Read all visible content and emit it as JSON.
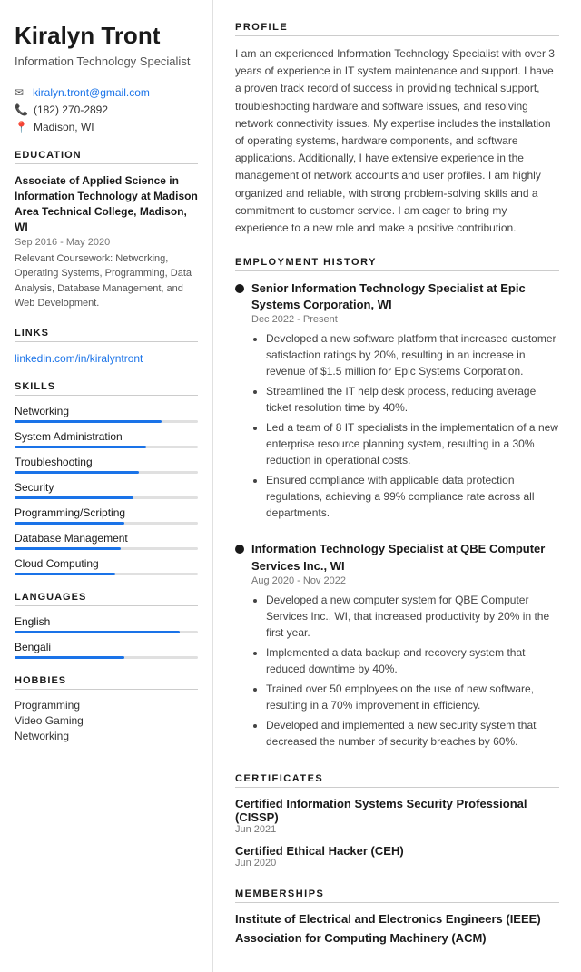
{
  "sidebar": {
    "name": "Kiralyn Tront",
    "title": "Information Technology Specialist",
    "contact": {
      "email": "kiralyn.tront@gmail.com",
      "phone": "(182) 270-2892",
      "location": "Madison, WI"
    },
    "education_title": "EDUCATION",
    "education": {
      "degree": "Associate of Applied Science in Information Technology at Madison Area Technical College, Madison, WI",
      "date": "Sep 2016 - May 2020",
      "courses": "Relevant Coursework: Networking, Operating Systems, Programming, Data Analysis, Database Management, and Web Development."
    },
    "links_title": "LINKS",
    "links": [
      {
        "text": "linkedin.com/in/kiralyntront",
        "url": "#"
      }
    ],
    "skills_title": "SKILLS",
    "skills": [
      {
        "name": "Networking",
        "pct": 80
      },
      {
        "name": "System Administration",
        "pct": 72
      },
      {
        "name": "Troubleshooting",
        "pct": 68
      },
      {
        "name": "Security",
        "pct": 65
      },
      {
        "name": "Programming/Scripting",
        "pct": 60
      },
      {
        "name": "Database Management",
        "pct": 58
      },
      {
        "name": "Cloud Computing",
        "pct": 55
      }
    ],
    "languages_title": "LANGUAGES",
    "languages": [
      {
        "name": "English",
        "pct": 90
      },
      {
        "name": "Bengali",
        "pct": 60
      }
    ],
    "hobbies_title": "HOBBIES",
    "hobbies": [
      "Programming",
      "Video Gaming",
      "Networking"
    ]
  },
  "main": {
    "profile_title": "PROFILE",
    "profile_text": "I am an experienced Information Technology Specialist with over 3 years of experience in IT system maintenance and support. I have a proven track record of success in providing technical support, troubleshooting hardware and software issues, and resolving network connectivity issues. My expertise includes the installation of operating systems, hardware components, and software applications. Additionally, I have extensive experience in the management of network accounts and user profiles. I am highly organized and reliable, with strong problem-solving skills and a commitment to customer service. I am eager to bring my experience to a new role and make a positive contribution.",
    "employment_title": "EMPLOYMENT HISTORY",
    "jobs": [
      {
        "title": "Senior Information Technology Specialist at Epic Systems Corporation, WI",
        "date": "Dec 2022 - Present",
        "bullets": [
          "Developed a new software platform that increased customer satisfaction ratings by 20%, resulting in an increase in revenue of $1.5 million for Epic Systems Corporation.",
          "Streamlined the IT help desk process, reducing average ticket resolution time by 40%.",
          "Led a team of 8 IT specialists in the implementation of a new enterprise resource planning system, resulting in a 30% reduction in operational costs.",
          "Ensured compliance with applicable data protection regulations, achieving a 99% compliance rate across all departments."
        ]
      },
      {
        "title": "Information Technology Specialist at QBE Computer Services Inc., WI",
        "date": "Aug 2020 - Nov 2022",
        "bullets": [
          "Developed a new computer system for QBE Computer Services Inc., WI, that increased productivity by 20% in the first year.",
          "Implemented a data backup and recovery system that reduced downtime by 40%.",
          "Trained over 50 employees on the use of new software, resulting in a 70% improvement in efficiency.",
          "Developed and implemented a new security system that decreased the number of security breaches by 60%."
        ]
      }
    ],
    "certificates_title": "CERTIFICATES",
    "certificates": [
      {
        "name": "Certified Information Systems Security Professional (CISSP)",
        "date": "Jun 2021"
      },
      {
        "name": "Certified Ethical Hacker (CEH)",
        "date": "Jun 2020"
      }
    ],
    "memberships_title": "MEMBERSHIPS",
    "memberships": [
      "Institute of Electrical and Electronics Engineers (IEEE)",
      "Association for Computing Machinery (ACM)"
    ]
  }
}
